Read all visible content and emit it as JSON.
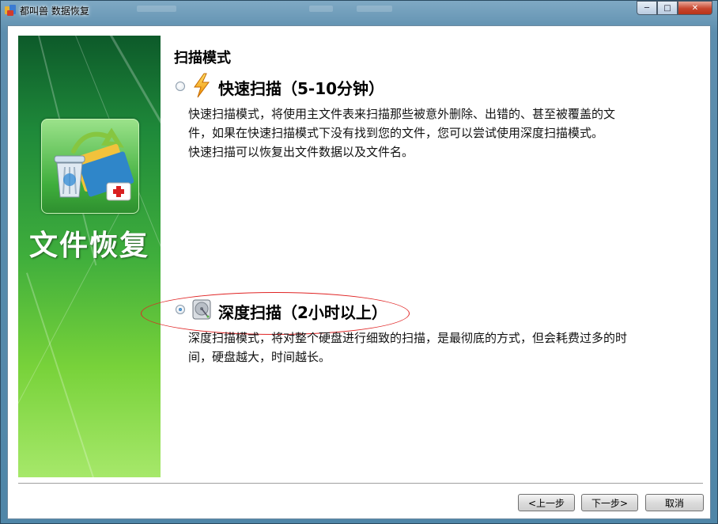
{
  "window": {
    "title": "都叫兽 数据恢复",
    "controls": {
      "minimize": "─",
      "maximize": "□",
      "close": "✕"
    },
    "icons": {
      "app": "app-icon"
    }
  },
  "banner": {
    "title": "文件恢复",
    "icon": "recycle-bin-folder-first-aid-icon"
  },
  "scan": {
    "section_title": "扫描模式",
    "quick": {
      "label": "快速扫描（5-10分钟）",
      "selected": false,
      "icon": "lightning-icon",
      "desc_lines": [
        "快速扫描模式，将使用主文件表来扫描那些被意外删除、出错的、甚至被覆盖的文",
        "件，如果在快速扫描模式下没有找到您的文件，您可以尝试使用深度扫描模式。",
        "快速扫描可以恢复出文件数据以及文件名。"
      ]
    },
    "deep": {
      "label": "深度扫描（2小时以上）",
      "selected": true,
      "icon": "hard-disk-icon",
      "desc_lines": [
        "深度扫描模式，将对整个硬盘进行细致的扫描，是最彻底的方式，但会耗费过多的时",
        "间，硬盘越大，时间越长。"
      ]
    }
  },
  "buttons": {
    "prev": "<上一步",
    "next": "下一步>",
    "cancel": "取消"
  },
  "colors": {
    "banner_dark": "#0d5a2a",
    "banner_light": "#a6e86a",
    "highlight_ellipse": "#e02424"
  }
}
